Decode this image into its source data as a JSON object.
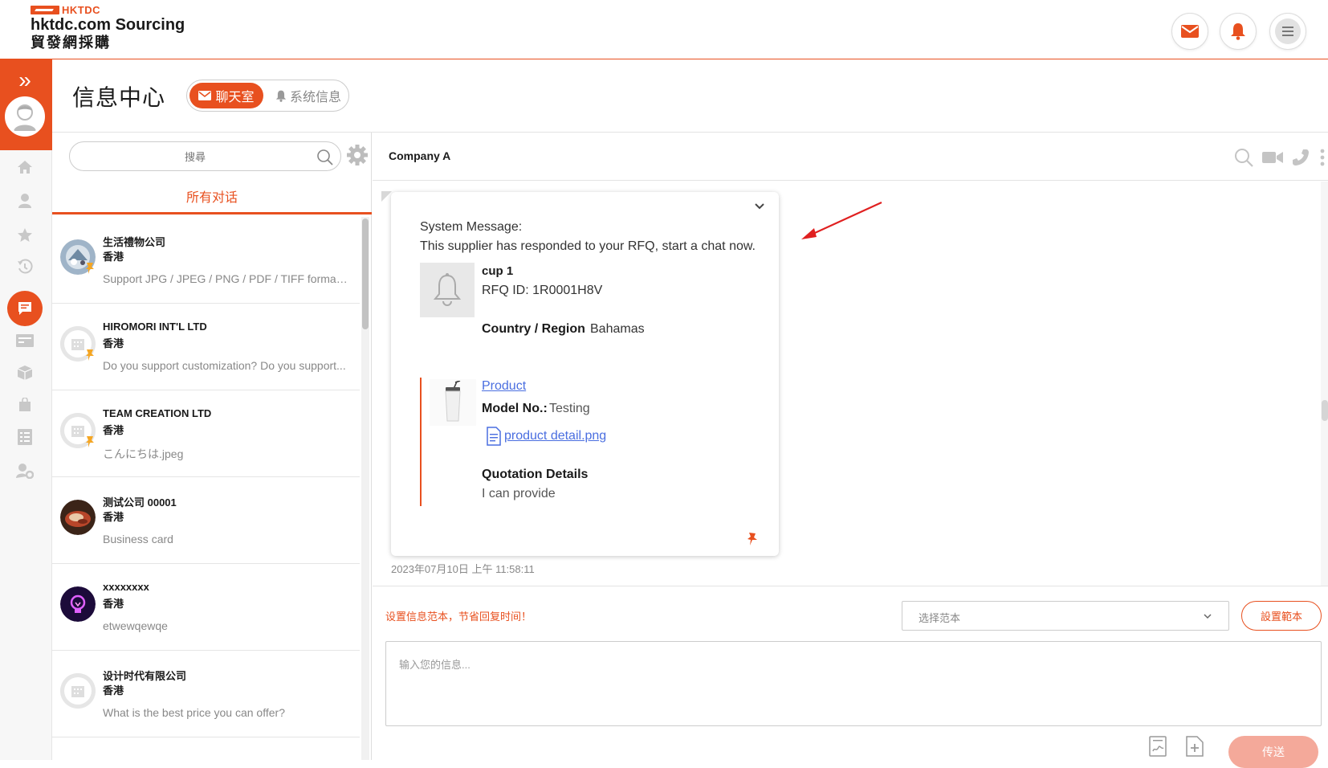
{
  "header": {
    "logo_mark": "HKTDC",
    "logo_title": "hktdc.com Sourcing",
    "logo_subtitle": "貿發網採購",
    "buttons": [
      {
        "icon": "mail-icon",
        "color": "#e8501f"
      },
      {
        "icon": "bell-icon",
        "color": "#e8501f"
      },
      {
        "icon": "menu-icon",
        "color": "#888888"
      }
    ]
  },
  "rail": {
    "items": [
      "home-icon",
      "user-icon",
      "star-icon",
      "history-icon",
      "chat-icon",
      "card-icon",
      "box-icon",
      "bag-icon",
      "list-icon",
      "user-settings-icon"
    ],
    "active": "chat-icon"
  },
  "page": {
    "title": "信息中心",
    "tabs": [
      {
        "label": "聊天室",
        "active": true
      },
      {
        "label": "系统信息",
        "active": false
      }
    ]
  },
  "conversations": {
    "search_placeholder": "搜尋",
    "filter_tab": "所有对话",
    "items": [
      {
        "name": "生活禮物公司",
        "region": "香港",
        "message": "Support JPG / JPEG / PNG / PDF / TIFF format..."
      },
      {
        "name": "HIROMORI INT'L LTD",
        "region": "香港",
        "message": "Do you support customization? Do you support..."
      },
      {
        "name": "TEAM CREATION LTD",
        "region": "香港",
        "message": "こんにちは.jpeg"
      },
      {
        "name": "测试公司 00001",
        "region": "香港",
        "message": "Business card"
      },
      {
        "name": "xxxxxxxx",
        "region": "香港",
        "message": "etwewqewqe"
      },
      {
        "name": "设计时代有限公司",
        "region": "香港",
        "message": "What is the best price you can offer?"
      }
    ]
  },
  "chat": {
    "title": "Company A",
    "message": {
      "system_label": "System Message:",
      "system_text": "This supplier has responded to your RFQ, start a chat now.",
      "rfq_product": "cup 1",
      "rfq_id": "RFQ ID: 1R0001H8V",
      "country_label": "Country / Region",
      "country_value": "Bahamas",
      "product_link": "Product",
      "model_label": "Model No.:",
      "model_value": "Testing",
      "file_name": "product detail.png",
      "quotation_label": "Quotation Details",
      "quotation_value": "I can provide"
    },
    "timestamp": "2023年07月10日 上午 11:58:11"
  },
  "composer": {
    "tip": "设置信息范本，节省回复时间！",
    "template_placeholder": "选择范本",
    "template_button": "設置範本",
    "input_placeholder": "输入您的信息...",
    "send_label": "传送"
  },
  "colors": {
    "accent": "#e8501f",
    "link": "#4a6ee0",
    "send_disabled": "#f4a99a"
  }
}
